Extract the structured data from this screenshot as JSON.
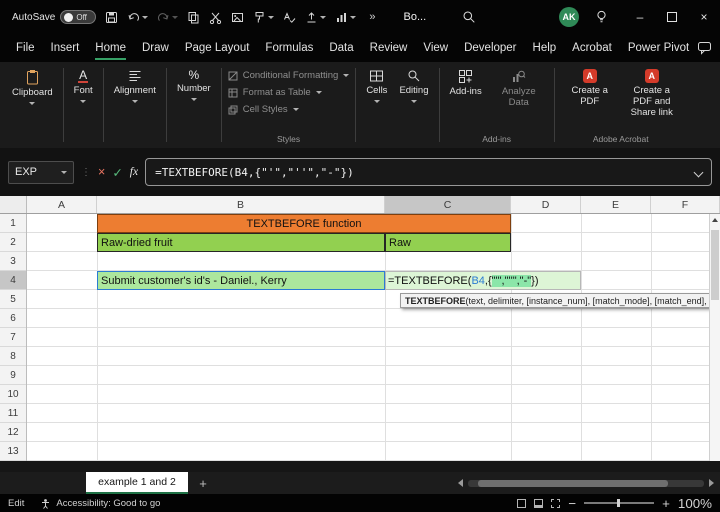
{
  "titlebar": {
    "autosave_label": "AutoSave",
    "autosave_state": "Off",
    "doc_title": "Bo...",
    "avatar_initials": "AK"
  },
  "menubar": {
    "items": [
      "File",
      "Insert",
      "Home",
      "Draw",
      "Page Layout",
      "Formulas",
      "Data",
      "Review",
      "View",
      "Developer",
      "Help",
      "Acrobat",
      "Power Pivot"
    ]
  },
  "ribbon": {
    "clipboard_label": "Clipboard",
    "font_label": "Font",
    "alignment_label": "Alignment",
    "number_label": "Number",
    "styles_items": [
      "Conditional Formatting",
      "Format as Table",
      "Cell Styles"
    ],
    "styles_group_label": "Styles",
    "cells_label": "Cells",
    "editing_label": "Editing",
    "addins_button_label": "Add-ins",
    "analyze_data_label": "Analyze Data",
    "addins_group_label": "Add-ins",
    "create_pdf_label": "Create a PDF",
    "create_pdf_share_label": "Create a PDF and Share link",
    "acrobat_group_label": "Adobe Acrobat"
  },
  "formula_bar": {
    "name_box_value": "EXP",
    "fx_label": "fx",
    "formula": "=TEXTBEFORE(B4,{\"'\",\"''\",\"-\"})"
  },
  "grid": {
    "col_headers": [
      "A",
      "B",
      "C",
      "D",
      "E",
      "F"
    ],
    "row_headers": [
      "1",
      "2",
      "3",
      "4",
      "5",
      "6",
      "7",
      "8",
      "9",
      "10",
      "11",
      "12",
      "13"
    ],
    "cells": {
      "title_banner": "TEXTBEFORE function",
      "b2": "Raw-dried fruit",
      "c2": "Raw",
      "b4": "Submit customer's id's - Daniel., Kerry"
    },
    "c4_formula": {
      "prefix": "=TEXTBEFORE(",
      "ref": "B4",
      "mid": ",{",
      "array": "\"'\",\"''\",\"-\"",
      "suffix": "})"
    },
    "tooltip": {
      "function_name": "TEXTBEFORE",
      "signature": "(text, delimiter, [instance_num], [match_mode], [match_end],"
    }
  },
  "sheet_tabs": {
    "active_tab_label": "example 1 and 2",
    "add_sheet_label": "+"
  },
  "status_bar": {
    "mode": "Edit",
    "accessibility_text": "Accessibility: Good to go",
    "zoom_out": "−",
    "zoom_in": "+",
    "zoom_level": "100%"
  },
  "icons": {
    "font_glyph": "A",
    "percent_glyph": "%",
    "overflow_glyph": "»",
    "acrobat_glyph": "A",
    "close_glyph": "×",
    "minimize_glyph": "–"
  },
  "colors": {
    "banner_orange": "#ED7D31",
    "cell_green": "#92D050",
    "highlight_green": "#ACE79D",
    "accent_green": "#1E7145",
    "reference_blue": "#2B7CD3"
  }
}
